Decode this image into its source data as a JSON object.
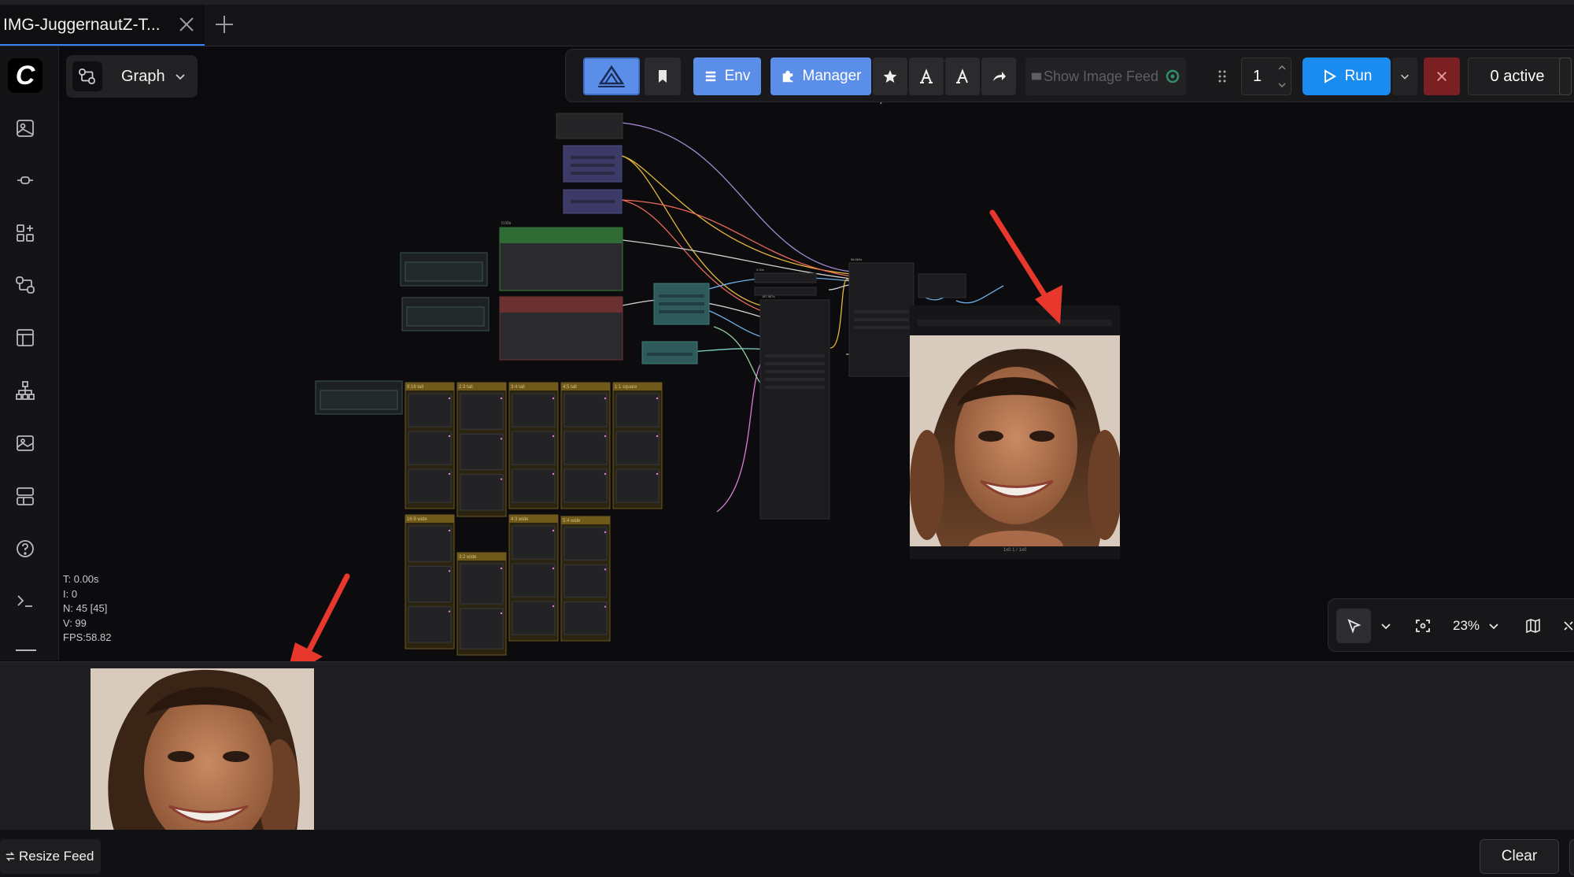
{
  "tab": {
    "title": "IMG-JuggernautZ-T..."
  },
  "graph_selector": {
    "label": "Graph"
  },
  "toolbar": {
    "env_label": "Env",
    "manager_label": "Manager",
    "show_image_feed_label": "Show Image Feed",
    "queue_count": "1",
    "run_label": "Run",
    "active_label": "0 active"
  },
  "canvas": {
    "stats": [
      "T: 0.00s",
      "I: 0",
      "N: 45 [45]",
      "V: 99",
      "FPS:58.82"
    ],
    "group_labels": [
      "9:16 tall",
      "2:3 tall",
      "3:4 tall",
      "4:5 tall",
      "1:1 square",
      "16:9 wide",
      "3:2 wide",
      "4:3 wide",
      "5:4 wide"
    ],
    "zoom_level": "23%"
  },
  "feed": {
    "resize_label": "Resize Feed",
    "clear_label": "Clear"
  },
  "icons": {
    "logo": "comfy-logo-icon",
    "sidebar": [
      "images-icon",
      "nodes-icon",
      "node-library-icon",
      "workflows-icon",
      "templates-icon",
      "model-library-icon",
      "queue-icon",
      "layout-icon",
      "help-icon",
      "terminal-icon"
    ]
  },
  "colors": {
    "accent_blue": "#5b8ee8",
    "run_blue": "#1a8cf0",
    "stop_red": "#7a1f22",
    "annotation_red": "#e8372c",
    "group_gold": "#6f5a1c"
  }
}
